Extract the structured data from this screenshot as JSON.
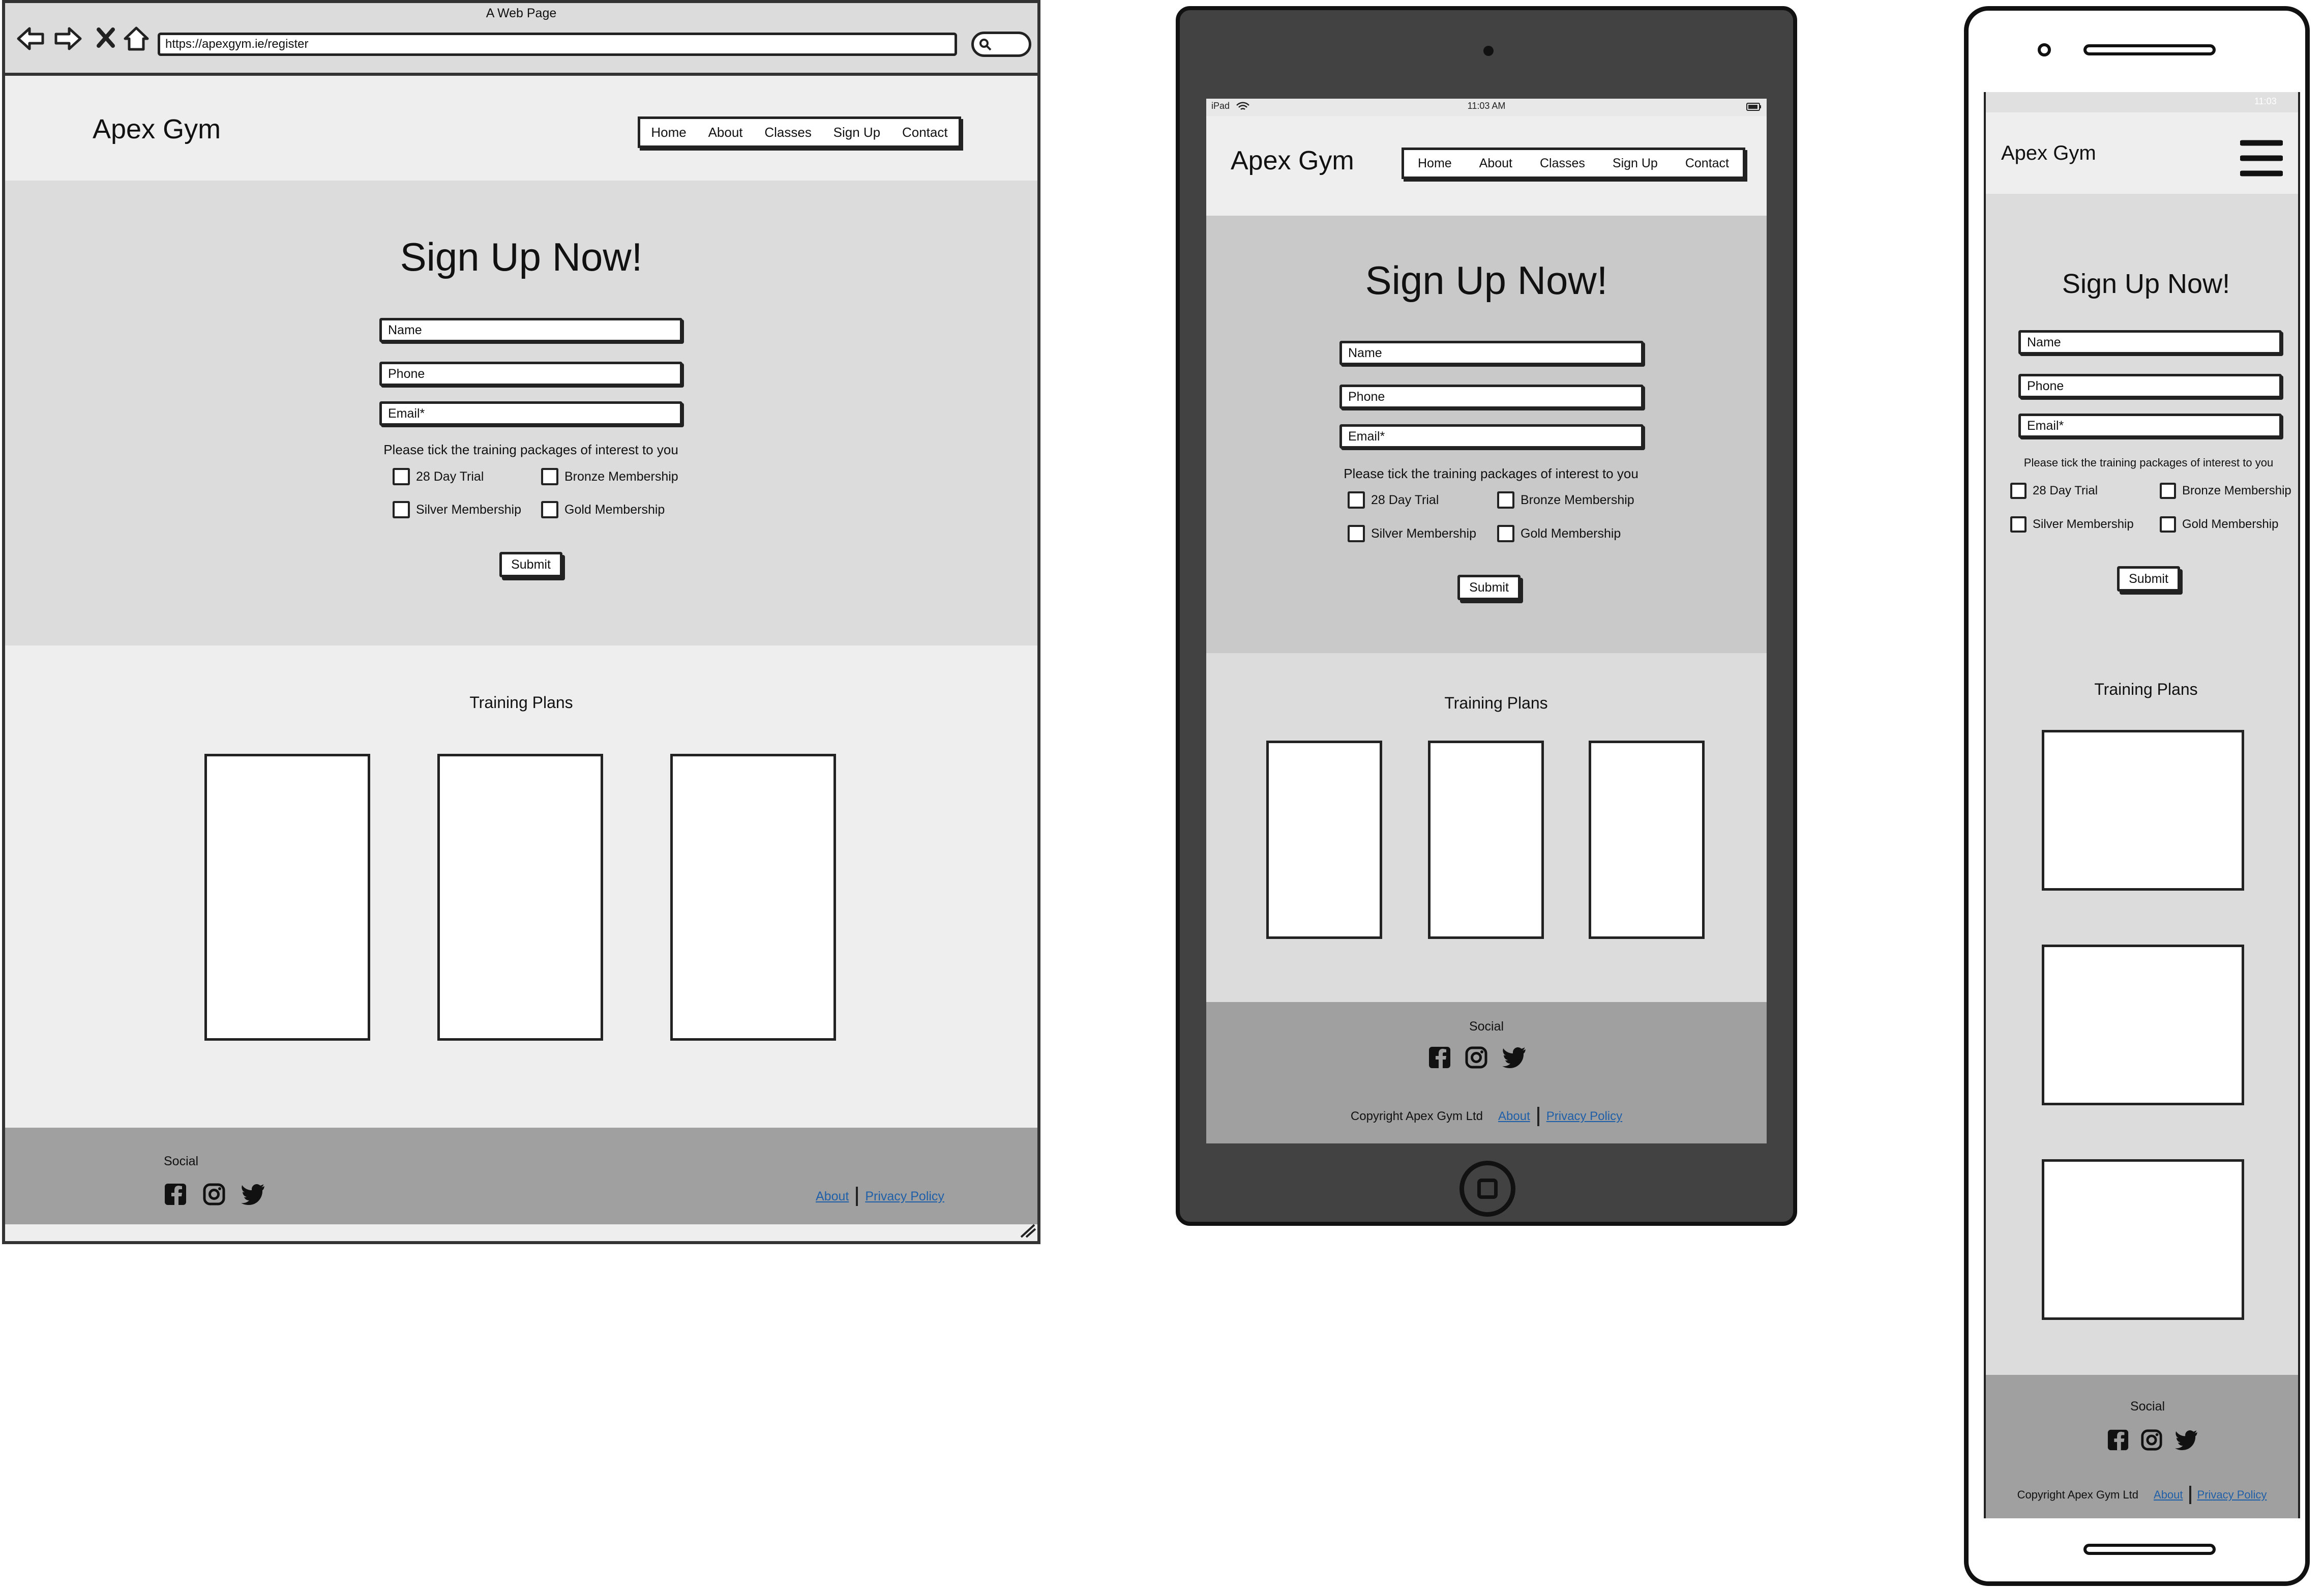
{
  "browser": {
    "window_title": "A Web Page",
    "url": "https://apexgym.ie/register"
  },
  "site": {
    "brand": "Apex Gym",
    "nav": [
      "Home",
      "About",
      "Classes",
      "Sign Up",
      "Contact"
    ],
    "signup_heading": "Sign Up Now!",
    "fields": {
      "name": "Name",
      "phone": "Phone",
      "email": "Email*"
    },
    "packages_prompt": "Please tick the training packages of interest to you",
    "packages": [
      "28 Day Trial",
      "Bronze Membership",
      "Silver Membership",
      "Gold Membership"
    ],
    "submit": "Submit",
    "plans_heading": "Training Plans",
    "social_heading": "Social",
    "copyright": "Copyright Apex Gym Ltd",
    "footer_links": [
      "About",
      "Privacy Policy"
    ]
  },
  "tablet_status": {
    "device": "iPad",
    "time": "11:03 AM"
  },
  "phone_status": {
    "time": "11:03"
  },
  "icons": [
    "facebook-icon",
    "instagram-icon",
    "twitter-icon",
    "hamburger-menu-icon",
    "back-arrow-icon",
    "forward-arrow-icon",
    "close-icon",
    "home-icon",
    "search-icon",
    "resize-grip-icon"
  ]
}
